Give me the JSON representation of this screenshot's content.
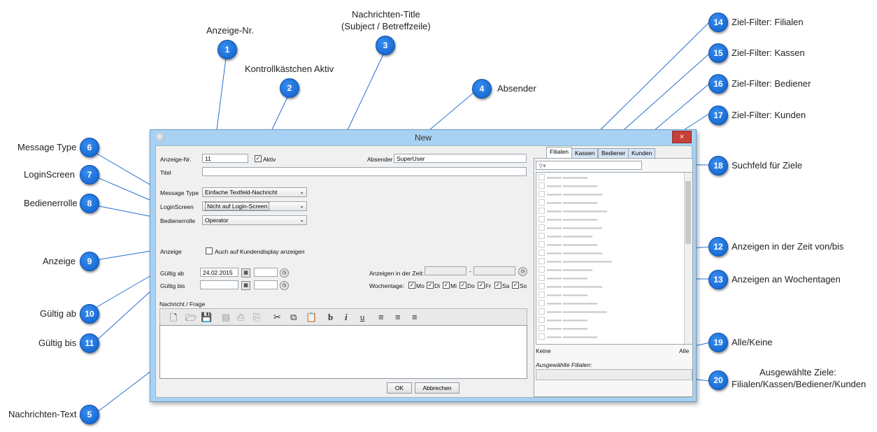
{
  "window": {
    "title": "New",
    "close_label": "×"
  },
  "form": {
    "anzeige_nr_label": "Anzeige-Nr.",
    "anzeige_nr_value": "11",
    "aktiv_label": "Aktiv",
    "aktiv_checked": "✓",
    "absender_label": "Absender",
    "absender_value": "SuperUser",
    "titel_label": "Titel",
    "titel_value": "",
    "message_type_label": "Message Type",
    "message_type_value": "Einfache Textfeld-Nachricht",
    "loginscreen_label": "LoginScreen",
    "loginscreen_value": "Nicht auf Login-Screen",
    "bedienerrolle_label": "Bedienerrolle",
    "bedienerrolle_value": "Operator",
    "anzeige_label": "Anzeige",
    "kundendisplay_label": "Auch auf Kundendisplay anzeigen",
    "gueltig_ab_label": "Gültig ab",
    "gueltig_ab_value": "24.02.2015",
    "gueltig_bis_label": "Gültig bis",
    "gueltig_bis_value": "",
    "anzeigen_zeit_label": "Anzeigen in der Zeit:",
    "zeit_separator": "-",
    "wochentage_label": "Wochentage:",
    "weekdays": [
      "Mo",
      "Di",
      "Mi",
      "Do",
      "Fr",
      "Sa",
      "So"
    ],
    "nachricht_label": "Nachricht / Frage",
    "toolbar": {
      "bold": "b",
      "italic": "i",
      "underline": "u"
    },
    "ok_label": "OK",
    "abbrechen_label": "Abbrechen"
  },
  "filter": {
    "tabs": [
      "Filialen",
      "Kassen",
      "Bediener",
      "Kunden"
    ],
    "search_placeholder": "",
    "keine_label": "Keine",
    "alle_label": "Alle",
    "ausgewaehlte_label": "Ausgewählte Filialen:"
  },
  "callouts": {
    "c1": "Anzeige-Nr.",
    "c2": "Kontrollkästchen Aktiv",
    "c3a": "Nachrichten-Title",
    "c3b": "(Subject / Betreffzeile)",
    "c4": "Absender",
    "c5": "Nachrichten-Text",
    "c6": "Message Type",
    "c7": "LoginScreen",
    "c8": "Bedienerrolle",
    "c9": "Anzeige",
    "c10": "Gültig ab",
    "c11": "Gültig bis",
    "c12": "Anzeigen in der Zeit von/bis",
    "c13": "Anzeigen an Wochentagen",
    "c14": "Ziel-Filter: Filialen",
    "c15": "Ziel-Filter: Kassen",
    "c16": "Ziel-Filter: Bediener",
    "c17": "Ziel-Filter: Kunden",
    "c18": "Suchfeld für Ziele",
    "c19": "Alle/Keine",
    "c20a": "Ausgewählte Ziele:",
    "c20b": "Filialen/Kassen/Bediener/Kunden"
  },
  "badges": [
    "1",
    "2",
    "3",
    "4",
    "5",
    "6",
    "7",
    "8",
    "9",
    "10",
    "11",
    "12",
    "13",
    "14",
    "15",
    "16",
    "17",
    "18",
    "19",
    "20"
  ],
  "colors": {
    "badge_blue": "#0a5fc9",
    "window_frame": "#a8d2f3",
    "close_red": "#c8403a"
  }
}
